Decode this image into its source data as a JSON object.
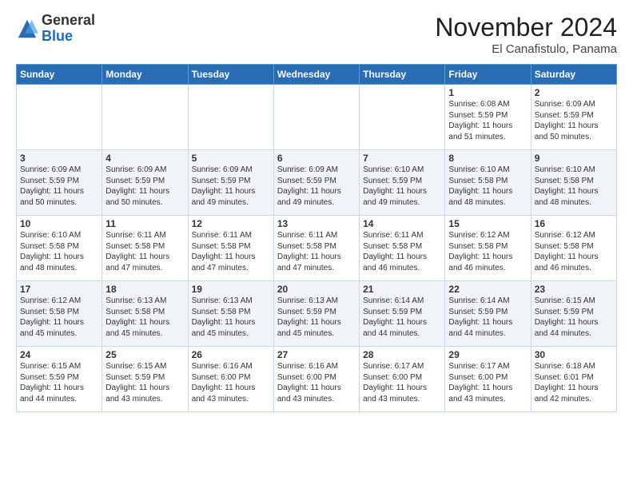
{
  "logo": {
    "general": "General",
    "blue": "Blue"
  },
  "header": {
    "month": "November 2024",
    "location": "El Canafistulo, Panama"
  },
  "weekdays": [
    "Sunday",
    "Monday",
    "Tuesday",
    "Wednesday",
    "Thursday",
    "Friday",
    "Saturday"
  ],
  "weeks": [
    [
      {
        "day": "",
        "info": ""
      },
      {
        "day": "",
        "info": ""
      },
      {
        "day": "",
        "info": ""
      },
      {
        "day": "",
        "info": ""
      },
      {
        "day": "",
        "info": ""
      },
      {
        "day": "1",
        "info": "Sunrise: 6:08 AM\nSunset: 5:59 PM\nDaylight: 11 hours and 51 minutes."
      },
      {
        "day": "2",
        "info": "Sunrise: 6:09 AM\nSunset: 5:59 PM\nDaylight: 11 hours and 50 minutes."
      }
    ],
    [
      {
        "day": "3",
        "info": "Sunrise: 6:09 AM\nSunset: 5:59 PM\nDaylight: 11 hours and 50 minutes."
      },
      {
        "day": "4",
        "info": "Sunrise: 6:09 AM\nSunset: 5:59 PM\nDaylight: 11 hours and 50 minutes."
      },
      {
        "day": "5",
        "info": "Sunrise: 6:09 AM\nSunset: 5:59 PM\nDaylight: 11 hours and 49 minutes."
      },
      {
        "day": "6",
        "info": "Sunrise: 6:09 AM\nSunset: 5:59 PM\nDaylight: 11 hours and 49 minutes."
      },
      {
        "day": "7",
        "info": "Sunrise: 6:10 AM\nSunset: 5:59 PM\nDaylight: 11 hours and 49 minutes."
      },
      {
        "day": "8",
        "info": "Sunrise: 6:10 AM\nSunset: 5:58 PM\nDaylight: 11 hours and 48 minutes."
      },
      {
        "day": "9",
        "info": "Sunrise: 6:10 AM\nSunset: 5:58 PM\nDaylight: 11 hours and 48 minutes."
      }
    ],
    [
      {
        "day": "10",
        "info": "Sunrise: 6:10 AM\nSunset: 5:58 PM\nDaylight: 11 hours and 48 minutes."
      },
      {
        "day": "11",
        "info": "Sunrise: 6:11 AM\nSunset: 5:58 PM\nDaylight: 11 hours and 47 minutes."
      },
      {
        "day": "12",
        "info": "Sunrise: 6:11 AM\nSunset: 5:58 PM\nDaylight: 11 hours and 47 minutes."
      },
      {
        "day": "13",
        "info": "Sunrise: 6:11 AM\nSunset: 5:58 PM\nDaylight: 11 hours and 47 minutes."
      },
      {
        "day": "14",
        "info": "Sunrise: 6:11 AM\nSunset: 5:58 PM\nDaylight: 11 hours and 46 minutes."
      },
      {
        "day": "15",
        "info": "Sunrise: 6:12 AM\nSunset: 5:58 PM\nDaylight: 11 hours and 46 minutes."
      },
      {
        "day": "16",
        "info": "Sunrise: 6:12 AM\nSunset: 5:58 PM\nDaylight: 11 hours and 46 minutes."
      }
    ],
    [
      {
        "day": "17",
        "info": "Sunrise: 6:12 AM\nSunset: 5:58 PM\nDaylight: 11 hours and 45 minutes."
      },
      {
        "day": "18",
        "info": "Sunrise: 6:13 AM\nSunset: 5:58 PM\nDaylight: 11 hours and 45 minutes."
      },
      {
        "day": "19",
        "info": "Sunrise: 6:13 AM\nSunset: 5:58 PM\nDaylight: 11 hours and 45 minutes."
      },
      {
        "day": "20",
        "info": "Sunrise: 6:13 AM\nSunset: 5:59 PM\nDaylight: 11 hours and 45 minutes."
      },
      {
        "day": "21",
        "info": "Sunrise: 6:14 AM\nSunset: 5:59 PM\nDaylight: 11 hours and 44 minutes."
      },
      {
        "day": "22",
        "info": "Sunrise: 6:14 AM\nSunset: 5:59 PM\nDaylight: 11 hours and 44 minutes."
      },
      {
        "day": "23",
        "info": "Sunrise: 6:15 AM\nSunset: 5:59 PM\nDaylight: 11 hours and 44 minutes."
      }
    ],
    [
      {
        "day": "24",
        "info": "Sunrise: 6:15 AM\nSunset: 5:59 PM\nDaylight: 11 hours and 44 minutes."
      },
      {
        "day": "25",
        "info": "Sunrise: 6:15 AM\nSunset: 5:59 PM\nDaylight: 11 hours and 43 minutes."
      },
      {
        "day": "26",
        "info": "Sunrise: 6:16 AM\nSunset: 6:00 PM\nDaylight: 11 hours and 43 minutes."
      },
      {
        "day": "27",
        "info": "Sunrise: 6:16 AM\nSunset: 6:00 PM\nDaylight: 11 hours and 43 minutes."
      },
      {
        "day": "28",
        "info": "Sunrise: 6:17 AM\nSunset: 6:00 PM\nDaylight: 11 hours and 43 minutes."
      },
      {
        "day": "29",
        "info": "Sunrise: 6:17 AM\nSunset: 6:00 PM\nDaylight: 11 hours and 43 minutes."
      },
      {
        "day": "30",
        "info": "Sunrise: 6:18 AM\nSunset: 6:01 PM\nDaylight: 11 hours and 42 minutes."
      }
    ]
  ]
}
